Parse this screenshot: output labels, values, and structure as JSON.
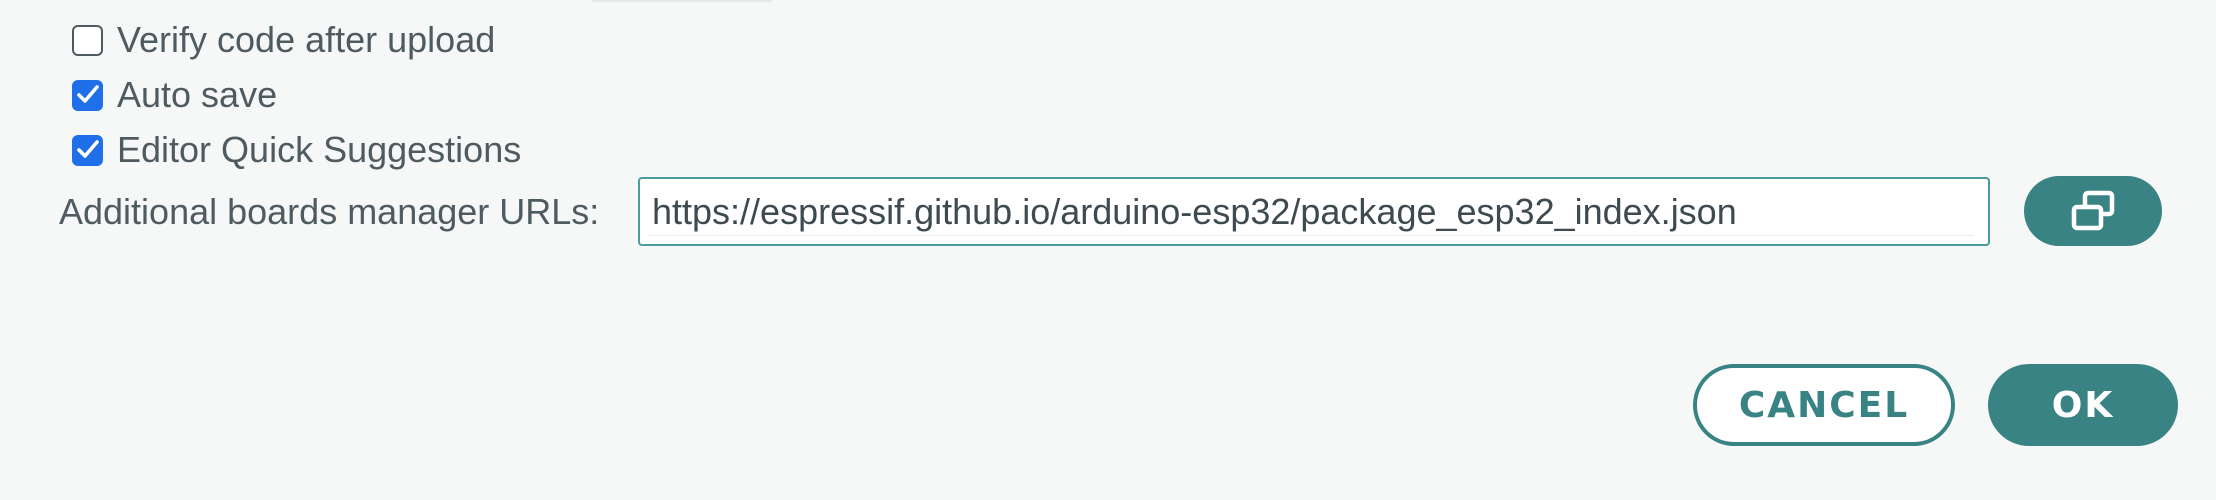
{
  "settings": {
    "checkboxes": [
      {
        "label": "Verify code after upload",
        "checked": false
      },
      {
        "label": "Auto save",
        "checked": true
      },
      {
        "label": "Editor Quick Suggestions",
        "checked": true
      }
    ],
    "boards_manager": {
      "label": "Additional boards manager URLs:",
      "value": "https://espressif.github.io/arduino-esp32/package_esp32_index.json",
      "open_dialog_icon": "windows-icon"
    }
  },
  "dialog_actions": {
    "cancel_label": "CANCEL",
    "ok_label": "OK"
  },
  "colors": {
    "accent": "#3a8385",
    "checkbox_checked": "#1f70e8",
    "text": "#4e5b61",
    "background": "#f6f8f8"
  }
}
